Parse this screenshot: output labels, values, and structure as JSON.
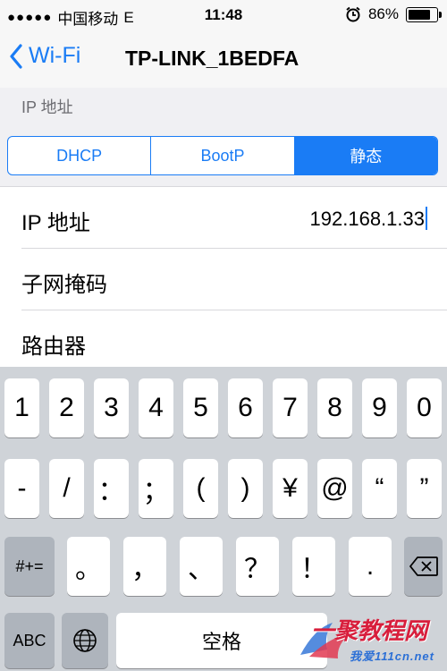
{
  "status_bar": {
    "signal_dots": "●●●●●",
    "carrier": "中国移动",
    "network": "E",
    "time": "11:48",
    "battery_percent": "86%",
    "battery_level": 0.86
  },
  "nav": {
    "back_label": "Wi-Fi",
    "title": "TP-LINK_1BEDFA"
  },
  "section": {
    "header": "IP 地址"
  },
  "segmented": {
    "options": [
      "DHCP",
      "BootP",
      "静态"
    ],
    "selected": "静态"
  },
  "fields": [
    {
      "label": "IP 地址",
      "value": "192.168.1.33"
    },
    {
      "label": "子网掩码",
      "value": ""
    },
    {
      "label": "路由器",
      "value": ""
    }
  ],
  "keyboard": {
    "row1": [
      "1",
      "2",
      "3",
      "4",
      "5",
      "6",
      "7",
      "8",
      "9",
      "0"
    ],
    "row2": [
      "-",
      "/",
      "：",
      "；",
      "(",
      ")",
      "¥",
      "@",
      "“",
      "”"
    ],
    "row3": [
      "#+=",
      "。",
      "，",
      "、",
      "？",
      "！",
      "."
    ],
    "row4": {
      "abc": "ABC",
      "space": "空格"
    }
  },
  "watermark": {
    "main": "一聚教程网",
    "sub": "我爱111cn.net"
  },
  "colors": {
    "accent": "#1a7cf5",
    "keyboard_bg": "#cfd3d8"
  }
}
